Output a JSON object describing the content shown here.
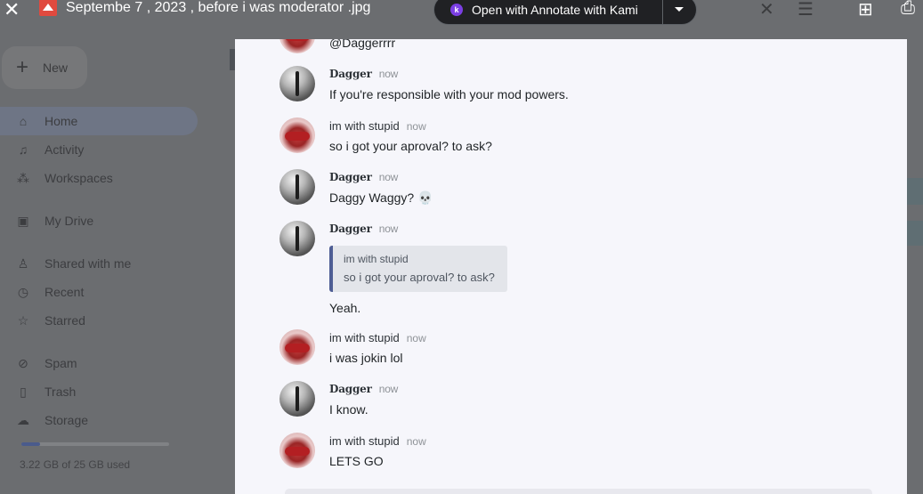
{
  "viewer": {
    "file_title": "Septembe 7 , 2023 , before i was moderator .jpg",
    "open_with_label": "Open with Annotate with Kami",
    "kami_letter": "k"
  },
  "drive": {
    "new_label": "New",
    "nav": [
      {
        "label": "Home",
        "icon": "home-icon"
      },
      {
        "label": "Activity",
        "icon": "bell-icon"
      },
      {
        "label": "Workspaces",
        "icon": "workspaces-icon"
      },
      {
        "label": "My Drive",
        "icon": "drive-icon"
      },
      {
        "label": "Shared with me",
        "icon": "people-icon"
      },
      {
        "label": "Recent",
        "icon": "clock-icon"
      },
      {
        "label": "Starred",
        "icon": "star-icon"
      },
      {
        "label": "Spam",
        "icon": "spam-icon"
      },
      {
        "label": "Trash",
        "icon": "trash-icon"
      },
      {
        "label": "Storage",
        "icon": "cloud-icon"
      }
    ],
    "storage_text": "3.22 GB of 25 GB used",
    "storage_used_fraction": 0.129
  },
  "chat": {
    "top_partial_text": "@Daggerrrr",
    "messages": [
      {
        "author": "Dagger",
        "time": "now",
        "text": "If you're responsible with your mod powers."
      },
      {
        "author": "im with stupid",
        "time": "now",
        "text": "so i got your aproval? to ask?"
      },
      {
        "author": "Dagger",
        "time": "now",
        "text": "Daggy Waggy? 💀"
      },
      {
        "author": "Dagger",
        "time": "now",
        "quote_author": "im with stupid",
        "quote_text": "so i got your aproval? to ask?",
        "text": "Yeah."
      },
      {
        "author": "im with stupid",
        "time": "now",
        "text": "i was jokin lol"
      },
      {
        "author": "Dagger",
        "time": "now",
        "text": "I know."
      },
      {
        "author": "im with stupid",
        "time": "now",
        "text": "LETS GO"
      }
    ]
  }
}
